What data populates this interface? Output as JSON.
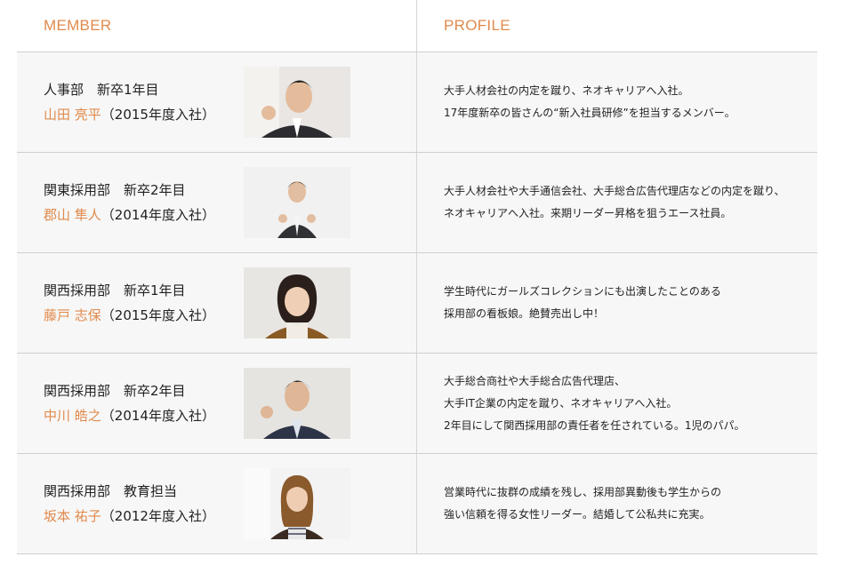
{
  "header": {
    "member_label": "MEMBER",
    "profile_label": "PROFILE"
  },
  "colors": {
    "accent": "#e08a4b",
    "row_bg": "#f7f7f7",
    "border": "#cfcfcf"
  },
  "members": [
    {
      "dept": "人事部　新卒1年目",
      "name": "山田 亮平",
      "year": "（2015年度入社）",
      "photo_icon": "male-photo-icon",
      "profile": [
        "大手人材会社の内定を蹴り、ネオキャリアへ入社。",
        "17年度新卒の皆さんの“新入社員研修”を担当するメンバー。"
      ]
    },
    {
      "dept": "関東採用部　新卒2年目",
      "name": "郡山 隼人",
      "year": "（2014年度入社）",
      "photo_icon": "male-photo-icon",
      "profile": [
        "大手人材会社や大手通信会社、大手総合広告代理店などの内定を蹴り、",
        "ネオキャリアへ入社。来期リーダー昇格を狙うエース社員。"
      ]
    },
    {
      "dept": "関西採用部　新卒1年目",
      "name": "藤戸 志保",
      "year": "（2015年度入社）",
      "photo_icon": "female-photo-icon",
      "profile": [
        "学生時代にガールズコレクションにも出演したことのある",
        "採用部の看板娘。絶賛売出し中！"
      ]
    },
    {
      "dept": "関西採用部　新卒2年目",
      "name": "中川 皓之",
      "year": "（2014年度入社）",
      "photo_icon": "male-photo-icon",
      "profile": [
        "大手総合商社や大手総合広告代理店、",
        "大手IT企業の内定を蹴り、ネオキャリアへ入社。",
        "2年目にして関西採用部の責任者を任されている。1児のパパ。"
      ]
    },
    {
      "dept": "関西採用部　教育担当",
      "name": "坂本 祐子",
      "year": "（2012年度入社）",
      "photo_icon": "female-photo-icon",
      "profile": [
        "営業時代に抜群の成績を残し、採用部異動後も学生からの",
        "強い信頼を得る女性リーダー。結婚して公私共に充実。"
      ]
    }
  ]
}
